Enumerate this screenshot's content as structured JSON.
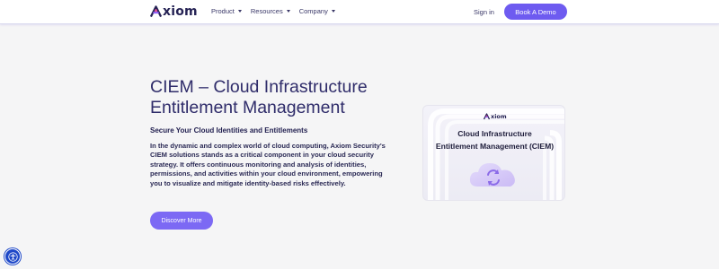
{
  "brand": {
    "name": "xiom",
    "accent": "#6e5bf0",
    "logo_icon": "axiom-logo-icon"
  },
  "nav": {
    "items": [
      {
        "label": "Product"
      },
      {
        "label": "Resources"
      },
      {
        "label": "Company"
      }
    ],
    "signin_label": "Sign in",
    "demo_label": "Book A Demo"
  },
  "hero": {
    "title": "CIEM – Cloud Infrastructure Entitlement Management",
    "subtitle": "Secure Your Cloud Identities and Entitlements",
    "body": "In the dynamic and complex world of cloud computing, Axiom Security's CIEM solutions stands as a critical component in your cloud security strategy. It offers continuous monitoring and analysis of identities, permissions, and activities within your cloud environment, empowering you to visualize and mitigate identity-based risks effectively.",
    "cta_label": "Discover More"
  },
  "card": {
    "logo_text": "xiom",
    "title_line1": "Cloud Infrastructure",
    "title_line2": "Entitlement Management (CIEM)",
    "illustration": "cloud-sync-icon"
  },
  "accessibility": {
    "icon": "accessibility-icon",
    "color": "#1e48c8"
  }
}
